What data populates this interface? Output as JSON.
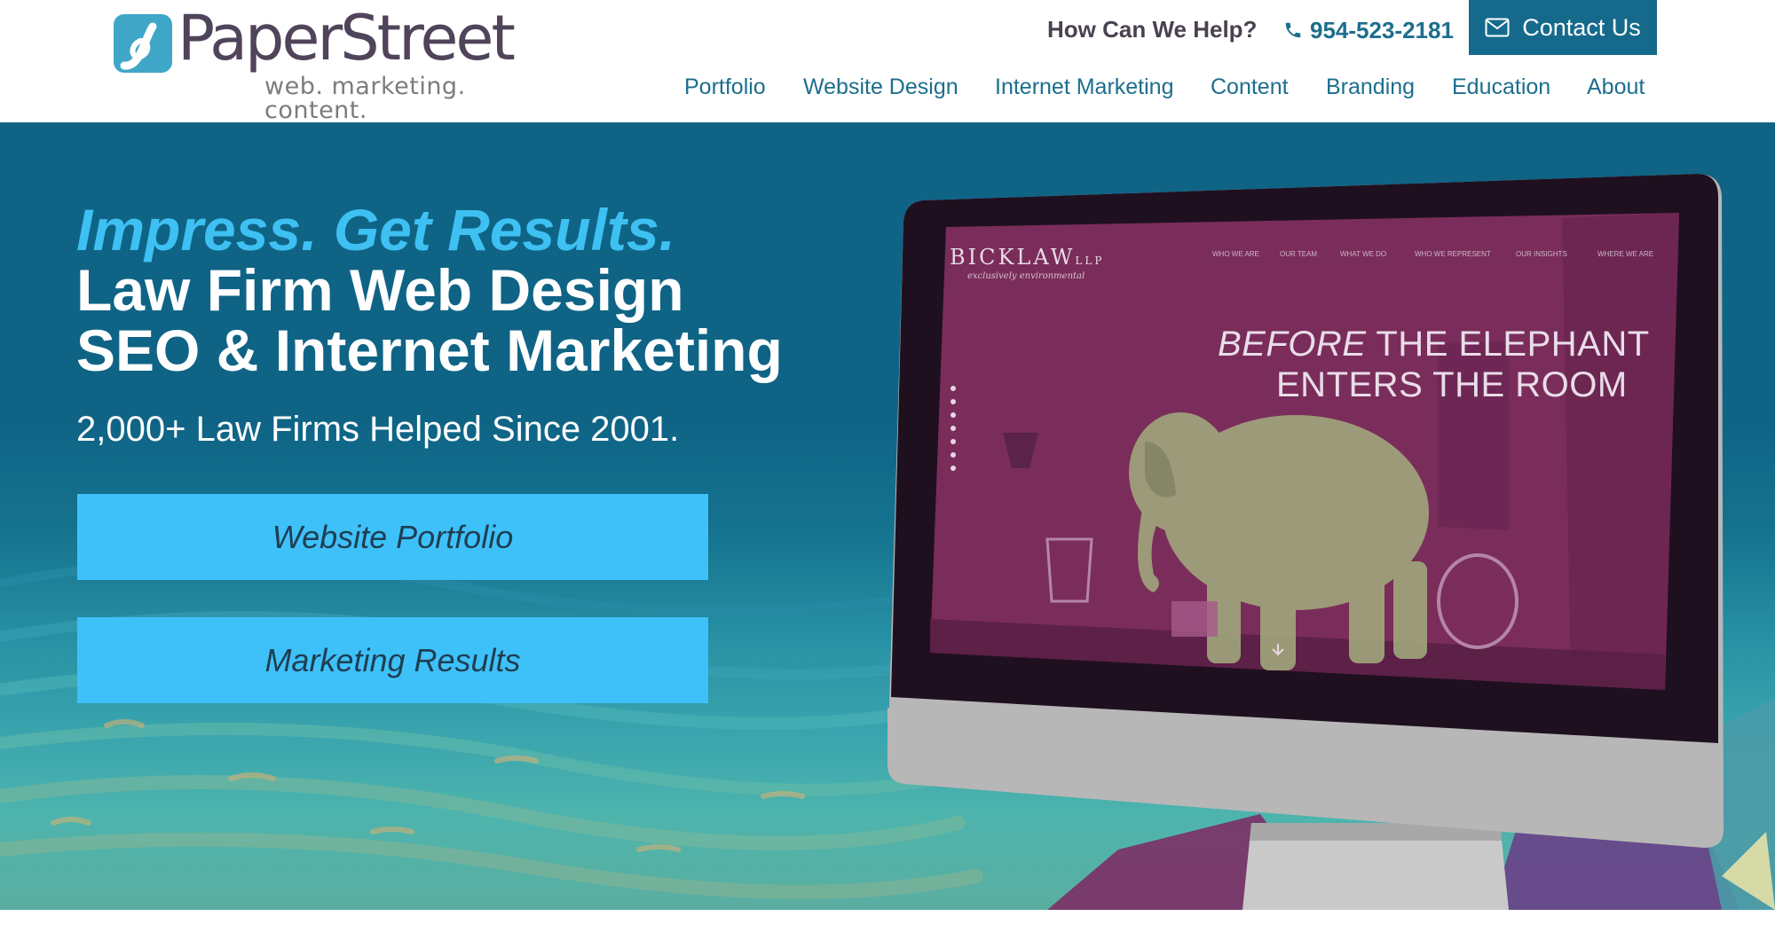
{
  "header": {
    "logo": {
      "name": "PaperStreet",
      "tagline": "web. marketing. content."
    },
    "help_text": "How Can We Help?",
    "phone": "954-523-2181",
    "contact_label": "Contact Us",
    "nav": [
      "Portfolio",
      "Website Design",
      "Internet Marketing",
      "Content",
      "Branding",
      "Education",
      "About"
    ]
  },
  "hero": {
    "headline_accent": "Impress. Get Results.",
    "headline_line1": "Law Firm Web Design",
    "headline_line2": "SEO & Internet Marketing",
    "subline": "2,000+ Law Firms Helped Since 2001.",
    "cta_primary": "Website Portfolio",
    "cta_secondary": "Marketing Results"
  },
  "screen": {
    "brand": "BICKLAW",
    "brand_suffix": "LLP",
    "tagline": "exclusively environmental",
    "nav": [
      "WHO WE ARE",
      "OUR TEAM",
      "WHAT WE DO",
      "WHO WE REPRESENT",
      "OUR INSIGHTS",
      "WHERE WE ARE"
    ],
    "headline_prefix": "BEFORE",
    "headline_rest": " THE ELEPHANT",
    "headline_line2": "ENTERS THE ROOM"
  },
  "colors": {
    "brand_dark": "#156a8b",
    "accent_blue": "#3ec1f2",
    "hero_bg": "#0f6486",
    "screen_magenta": "#7a2d5a"
  },
  "icons": [
    "phone-icon",
    "envelope-icon"
  ]
}
